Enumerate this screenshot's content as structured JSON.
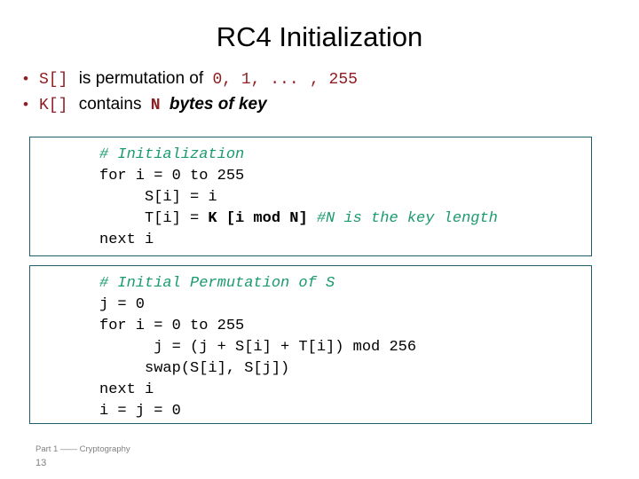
{
  "slide": {
    "title": "RC4 Initialization",
    "bullets": [
      {
        "marker": "•",
        "parts": [
          {
            "text": "S[]",
            "style": "mono-red"
          },
          {
            "text": "is permutation of",
            "style": "sans-plain"
          },
          {
            "text": "0, 1, ...",
            "style": "mono-red"
          },
          {
            "text": ", 255",
            "style": "mono-red"
          }
        ]
      },
      {
        "marker": "•",
        "parts": [
          {
            "text": "K[]",
            "style": "mono-red"
          },
          {
            "text": "contains",
            "style": "sans-plain"
          },
          {
            "text": "N",
            "style": "mono-red-b"
          },
          {
            "text": "bytes of key",
            "style": "sans-bi"
          }
        ]
      }
    ],
    "code_boxes": [
      {
        "name": "initialization",
        "lines": [
          [
            {
              "text": "# Initialization",
              "style": "cmt"
            }
          ],
          [
            {
              "text": "for i = 0 to 255",
              "style": "plain"
            }
          ],
          [
            {
              "text": "     S[i] = i",
              "style": "plain"
            }
          ],
          [
            {
              "text": "     T[i] = ",
              "style": "plain"
            },
            {
              "text": "K [i mod N]",
              "style": "bold"
            },
            {
              "text": " ",
              "style": "plain"
            },
            {
              "text": "#N is the key length",
              "style": "cmt"
            }
          ],
          [
            {
              "text": "next i",
              "style": "plain"
            }
          ]
        ]
      },
      {
        "name": "initial-permutation",
        "lines": [
          [
            {
              "text": "# Initial Permutation of S",
              "style": "cmt"
            }
          ],
          [
            {
              "text": "j = 0",
              "style": "plain"
            }
          ],
          [
            {
              "text": "for i = 0 to 255",
              "style": "plain"
            }
          ],
          [
            {
              "text": "      j = (j + S[i] + T[i]) mod 256",
              "style": "plain"
            }
          ],
          [
            {
              "text": "     swap(S[i], S[j])",
              "style": "plain"
            }
          ],
          [
            {
              "text": "next i",
              "style": "plain"
            }
          ],
          [
            {
              "text": "i = j = 0",
              "style": "plain"
            }
          ]
        ]
      }
    ],
    "footer": {
      "course": "Part 1 —— Cryptography",
      "page": "13"
    },
    "colors": {
      "accent_red": "#8f1d22",
      "comment_green": "#1a9a6e",
      "box_border": "#1f5f6b",
      "text": "#000000",
      "footer_gray": "#808080"
    }
  }
}
